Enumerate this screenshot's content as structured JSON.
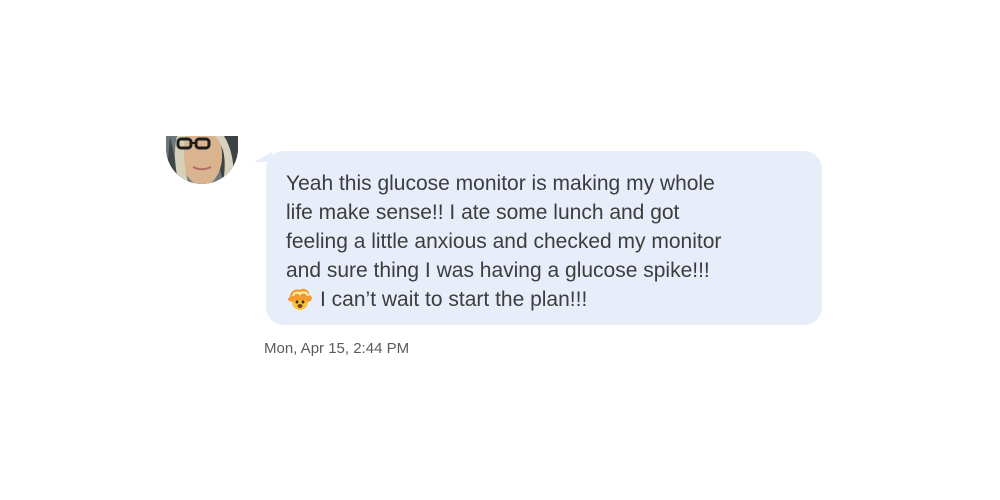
{
  "message": {
    "lines": [
      "Yeah this glucose monitor is making my whole",
      "life make sense!! I ate some lunch and got",
      "feeling a little anxious and checked my monitor",
      "and sure thing I was having a glucose spike!!!",
      "I can’t wait to start the plan!!!"
    ],
    "emoji_icon": "exploding-head-emoji",
    "bubble_color": "#e8edfa",
    "text_color": "#3d3d3d"
  },
  "timestamp": "Mon, Apr 15, 2:44 PM"
}
